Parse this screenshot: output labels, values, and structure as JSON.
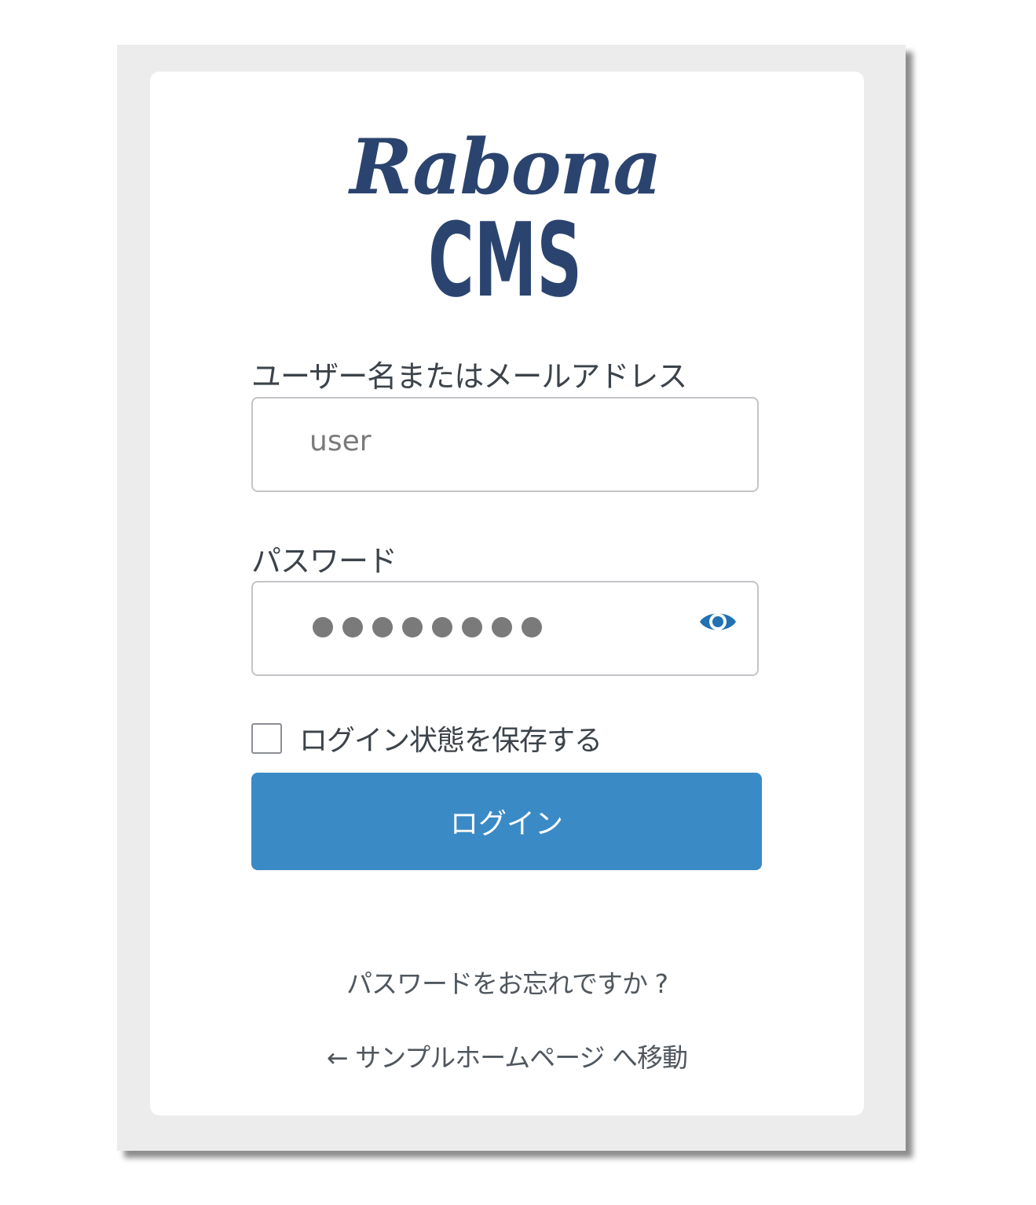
{
  "brand": {
    "script_text": "Rabona",
    "sub_text": "CMS",
    "color": "#2b446f"
  },
  "username": {
    "label": "ユーザー名またはメールアドレス",
    "value": "user"
  },
  "password": {
    "label": "パスワード",
    "masked_length": 8,
    "toggle_icon": "eye-icon"
  },
  "remember": {
    "label": "ログイン状態を保存する",
    "checked": false
  },
  "login_button": {
    "label": "ログイン",
    "color": "#3a8ac6"
  },
  "links": {
    "lost_password": "パスワードをお忘れですか ?",
    "back_to_site": "← サンプルホームページ へ移動"
  }
}
